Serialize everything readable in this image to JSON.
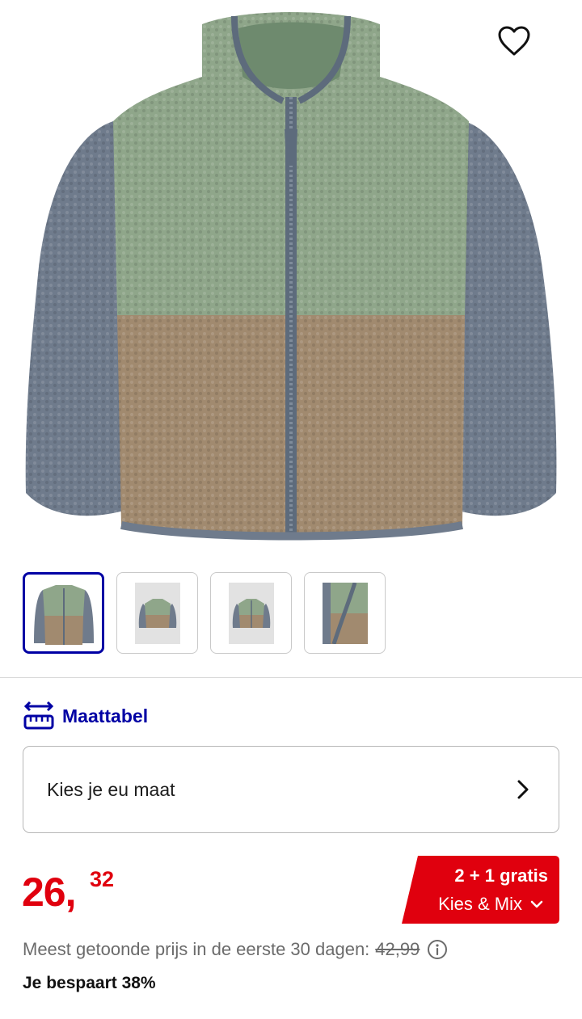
{
  "product": {
    "image_icon": "fleece-jacket-image",
    "favorite_icon": "heart-outline-icon"
  },
  "thumbnails": [
    {
      "name": "thumbnail-1",
      "icon": "jacket-front-image",
      "active": true
    },
    {
      "name": "thumbnail-2",
      "icon": "jacket-small-front-image",
      "active": false
    },
    {
      "name": "thumbnail-3",
      "icon": "jacket-small-front-image",
      "active": false
    },
    {
      "name": "thumbnail-4",
      "icon": "jacket-zipper-detail-image",
      "active": false
    }
  ],
  "size": {
    "chart_label": "Maattabel",
    "chart_icon": "ruler-arrows-icon",
    "select_label": "Kies je eu maat",
    "select_icon": "chevron-right-icon"
  },
  "price": {
    "integer": "26",
    "comma": ",",
    "fraction": "32",
    "color": "#e0000e"
  },
  "promo": {
    "line1": "2 + 1 gratis",
    "line2": "Kies & Mix",
    "icon": "chevron-down-icon",
    "color": "#e0000e"
  },
  "lowest_price": {
    "text": "Meest getoonde prijs in de eerste 30 dagen:",
    "old_price": "42,99",
    "icon": "info-icon"
  },
  "savings": "Je bespaart 38%",
  "colors": {
    "accent_blue": "#0000a4",
    "sale_red": "#e0000e",
    "muted_text": "#6b6b6b"
  }
}
